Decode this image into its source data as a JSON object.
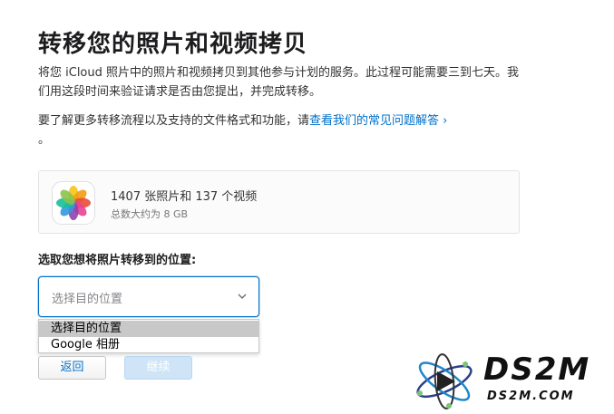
{
  "page": {
    "title": "转移您的照片和视频拷贝",
    "description": "将您 iCloud 照片中的照片和视频拷贝到其他参与计划的服务。此过程可能需要三到七天。我们用这段时间来验证请求是否由您提出，并完成转移。",
    "learn_more_prefix": "要了解更多转移流程以及支持的文件格式和功能，请",
    "learn_more_link": "查看我们的常见问题解答 ›",
    "learn_more_suffix": "。"
  },
  "summary": {
    "icon": "photos-app-icon",
    "count_text": "1407 张照片和 137 个视频",
    "size_text": "总数大约为 8 GB"
  },
  "destination": {
    "prompt": "选取您想将照片转移到的位置:",
    "placeholder": "选择目的位置",
    "options": [
      "选择目的位置",
      "Google 相册"
    ]
  },
  "buttons": {
    "back": "返回",
    "continue": "继续"
  },
  "watermark": {
    "big": "DS2M",
    "small": "DS2M.COM"
  },
  "colors": {
    "link": "#0070c9",
    "focus_border": "#0070c9",
    "disabled_button": "#cfe4f7",
    "selected_option": "#c8c8c8"
  }
}
